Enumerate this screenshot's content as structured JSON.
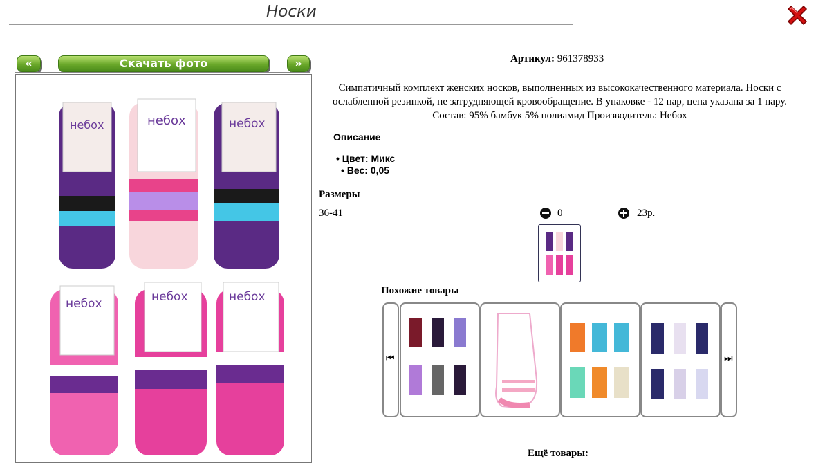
{
  "header": {
    "title": "Носки"
  },
  "gallery": {
    "prev_label": "«",
    "download_label": "Скачать фото",
    "next_label": "»"
  },
  "product": {
    "article_label": "Артикул:",
    "article_value": "961378933",
    "description": "Симпатичный комплект женских носков, выполненных из высококачественного материала. Носки с ослабленной резинкой, не затрудняющей кровообращение. В упаковке - 12 пар, цена указана за 1 пару. Состав: 95% бамбук 5% полиамид Производитель: Небох",
    "features_heading": "Описание",
    "features": [
      "Цвет: Микс",
      "Вес: 0,05"
    ]
  },
  "sizes": {
    "heading": "Размеры",
    "rows": [
      {
        "size": "36-41",
        "quantity": "0",
        "price": "23р."
      }
    ]
  },
  "similar": {
    "heading": "Похожие товары"
  },
  "more": {
    "heading": "Ещё товары:"
  },
  "colors": {
    "nav_green": "#6aa82a",
    "close_red": "#cc1111"
  }
}
